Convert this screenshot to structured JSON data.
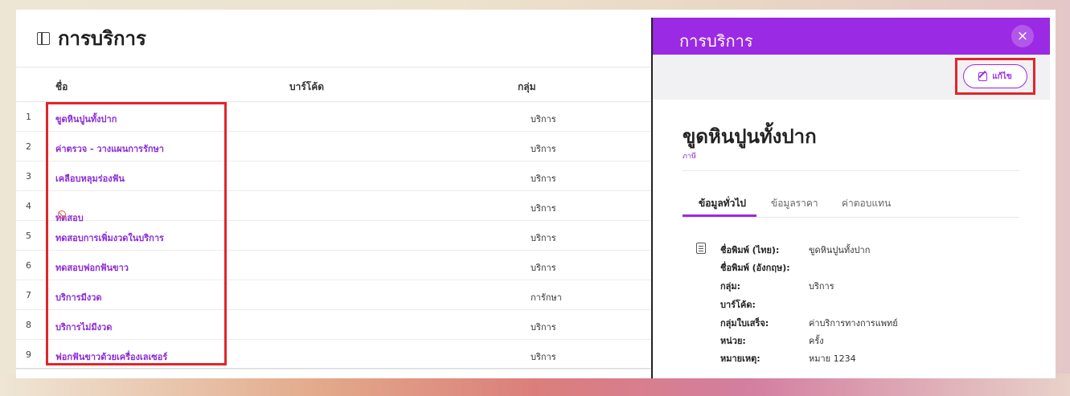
{
  "page": {
    "title": "การบริการ"
  },
  "table": {
    "headers": {
      "name": "ชื่อ",
      "barcode": "บาร์โค้ด",
      "group": "กลุ่ม"
    },
    "rows": [
      {
        "num": "1",
        "name": "ขูดหินปูนทั้งปาก",
        "group": "บริการ"
      },
      {
        "num": "2",
        "name": "ค่าตรวจ - วางแผนการรักษา",
        "group": "บริการ"
      },
      {
        "num": "3",
        "name": "เคลือบหลุมร่องฟัน",
        "group": "บริการ"
      },
      {
        "num": "4",
        "name": "ทดสอบ",
        "group": "บริการ",
        "disabled": true
      },
      {
        "num": "5",
        "name": "ทดสอบการเพิ่มงวดในบริการ",
        "group": "บริการ"
      },
      {
        "num": "6",
        "name": "ทดสอบฟอกฟันขาว",
        "group": "บริการ"
      },
      {
        "num": "7",
        "name": "บริการมีงวด",
        "group": "การักษา"
      },
      {
        "num": "8",
        "name": "บริการไม่มีงวด",
        "group": "บริการ"
      },
      {
        "num": "9",
        "name": "ฟอกฟันขาวด้วยเครื่องเลเซอร์",
        "group": "บริการ"
      }
    ]
  },
  "panel": {
    "title": "การบริการ",
    "close_label": "×",
    "edit_label": "แก้ไข",
    "item_name": "ขูดหินปูนทั้งปาก",
    "item_sub": "ภาษี",
    "tabs": [
      "ข้อมูลทั่วไป",
      "ข้อมูลราคา",
      "ค่าตอบแทน"
    ],
    "details": [
      {
        "label": "ชื่อพิมพ์ (ไทย):",
        "value": "ขูดหินปูนทั้งปาก"
      },
      {
        "label": "ชื่อพิมพ์ (อังกฤษ):",
        "value": ""
      },
      {
        "label": "กลุ่ม:",
        "value": "บริการ"
      },
      {
        "label": "บาร์โค้ด:",
        "value": ""
      },
      {
        "label": "กลุ่มใบเสร็จ:",
        "value": "ค่าบริการทางการแพทย์"
      },
      {
        "label": "หน่วย:",
        "value": "ครั้ง"
      },
      {
        "label": "หมายเหตุ:",
        "value": "หมาย 1234"
      }
    ]
  },
  "colors": {
    "accent": "#9b2ae4",
    "highlight": "#e0262b",
    "link": "#8b2bd6"
  },
  "icons": {
    "title": "book-icon",
    "close": "close-icon",
    "edit": "edit-icon",
    "details": "document-icon",
    "disabled": "ban-icon"
  }
}
